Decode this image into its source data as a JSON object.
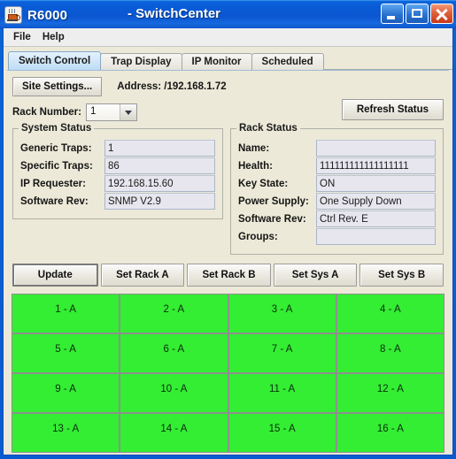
{
  "window": {
    "icon_name": "java-coffee-cup-icon",
    "title": "R6000",
    "app_name": "- SwitchCenter",
    "caption": {
      "minimize": "minimize-button",
      "maximize": "maximize-button",
      "close": "close-button"
    }
  },
  "menubar": {
    "items": [
      {
        "label": "File"
      },
      {
        "label": "Help"
      }
    ]
  },
  "tabs": [
    {
      "label": "Switch Control",
      "active": true
    },
    {
      "label": "Trap Display",
      "active": false
    },
    {
      "label": "IP Monitor",
      "active": false
    },
    {
      "label": "Scheduled",
      "active": false
    }
  ],
  "toolbar": {
    "site_settings_label": "Site Settings...",
    "address_label": "Address: /192.168.1.72",
    "rack_number_label": "Rack Number:",
    "rack_number_value": "1",
    "refresh_label": "Refresh Status"
  },
  "system_status": {
    "legend": "System Status",
    "fields": [
      {
        "label": "Generic Traps:",
        "value": "1"
      },
      {
        "label": "Specific Traps:",
        "value": "86"
      },
      {
        "label": "IP Requester:",
        "value": "192.168.15.60"
      },
      {
        "label": "Software Rev:",
        "value": "SNMP V2.9"
      }
    ]
  },
  "rack_status": {
    "legend": "Rack Status",
    "fields": [
      {
        "label": "Name:",
        "value": ""
      },
      {
        "label": "Health:",
        "value": "111111111111111111"
      },
      {
        "label": "Key State:",
        "value": "ON"
      },
      {
        "label": "Power Supply:",
        "value": "One Supply Down"
      },
      {
        "label": "Software Rev:",
        "value": "Ctrl Rev. E"
      },
      {
        "label": "Groups:",
        "value": ""
      }
    ]
  },
  "actions": [
    {
      "label": "Update",
      "default": true
    },
    {
      "label": "Set Rack A",
      "default": false
    },
    {
      "label": "Set Rack B",
      "default": false
    },
    {
      "label": "Set Sys A",
      "default": false
    },
    {
      "label": "Set Sys B",
      "default": false
    }
  ],
  "port_grid": {
    "color": "#33ee33",
    "cells": [
      {
        "label": "1 - A"
      },
      {
        "label": "2 - A"
      },
      {
        "label": "3 - A"
      },
      {
        "label": "4 - A"
      },
      {
        "label": "5 - A"
      },
      {
        "label": "6 - A"
      },
      {
        "label": "7 - A"
      },
      {
        "label": "8 - A"
      },
      {
        "label": "9 - A"
      },
      {
        "label": "10 - A"
      },
      {
        "label": "11 - A"
      },
      {
        "label": "12 - A"
      },
      {
        "label": "13 - A"
      },
      {
        "label": "14 - A"
      },
      {
        "label": "15 - A"
      },
      {
        "label": "16 - A"
      }
    ]
  },
  "colors": {
    "titlebar": "#0a58d4",
    "client_bg": "#ece9d8",
    "field_bg": "#e7e6ee",
    "port_green": "#33ee33",
    "tab_active": "#bedcf4"
  }
}
